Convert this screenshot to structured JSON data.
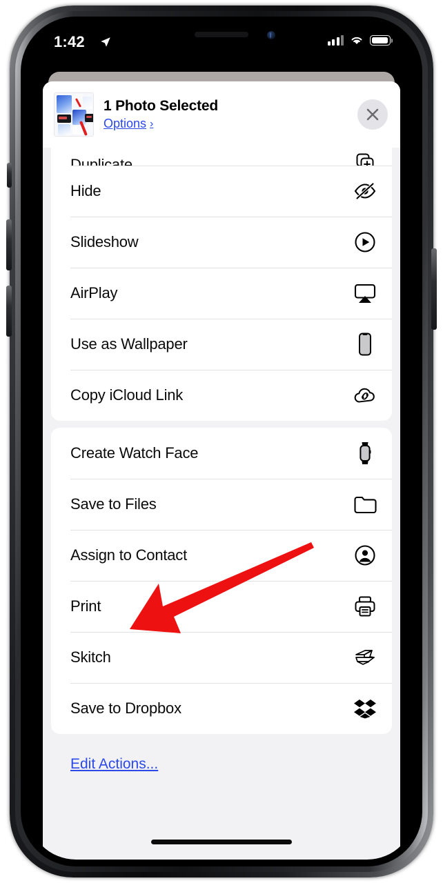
{
  "status_bar": {
    "time": "1:42",
    "location_icon": "location-arrow-icon",
    "cellular_icon": "cellular-bars-icon",
    "wifi_icon": "wifi-icon",
    "battery_icon": "battery-full-icon"
  },
  "share_sheet": {
    "title": "1 Photo Selected",
    "options_label": "Options",
    "options_chevron": "›",
    "close_icon": "close-icon",
    "thumbnail_name": "selected-photo-thumbnail",
    "groups": [
      {
        "name": "photo-actions-group",
        "items": [
          {
            "label": "Duplicate",
            "icon": "duplicate-icon",
            "partial": true
          },
          {
            "label": "Hide",
            "icon": "eye-slash-icon",
            "partial": false
          },
          {
            "label": "Slideshow",
            "icon": "play-circle-icon",
            "partial": false
          },
          {
            "label": "AirPlay",
            "icon": "airplay-icon",
            "partial": false
          },
          {
            "label": "Use as Wallpaper",
            "icon": "iphone-icon",
            "partial": false
          },
          {
            "label": "Copy iCloud Link",
            "icon": "cloud-link-icon",
            "partial": false
          }
        ]
      },
      {
        "name": "app-actions-group",
        "items": [
          {
            "label": "Create Watch Face",
            "icon": "apple-watch-icon",
            "partial": false
          },
          {
            "label": "Save to Files",
            "icon": "folder-icon",
            "partial": false
          },
          {
            "label": "Assign to Contact",
            "icon": "person-circle-icon",
            "partial": false
          },
          {
            "label": "Print",
            "icon": "printer-icon",
            "partial": false
          },
          {
            "label": "Skitch",
            "icon": "skitch-icon",
            "partial": false
          },
          {
            "label": "Save to Dropbox",
            "icon": "dropbox-icon",
            "partial": false
          }
        ]
      }
    ],
    "edit_actions_label": "Edit Actions..."
  },
  "annotation": {
    "name": "red-arrow-annotation",
    "color": "#ee1111",
    "points_to": "Print"
  },
  "colors": {
    "link_blue": "#2b49e8",
    "sheet_background": "#f2f2f4",
    "row_background": "#ffffff",
    "separator": "#e0e0e3",
    "close_button_background": "#e4e4e8"
  }
}
